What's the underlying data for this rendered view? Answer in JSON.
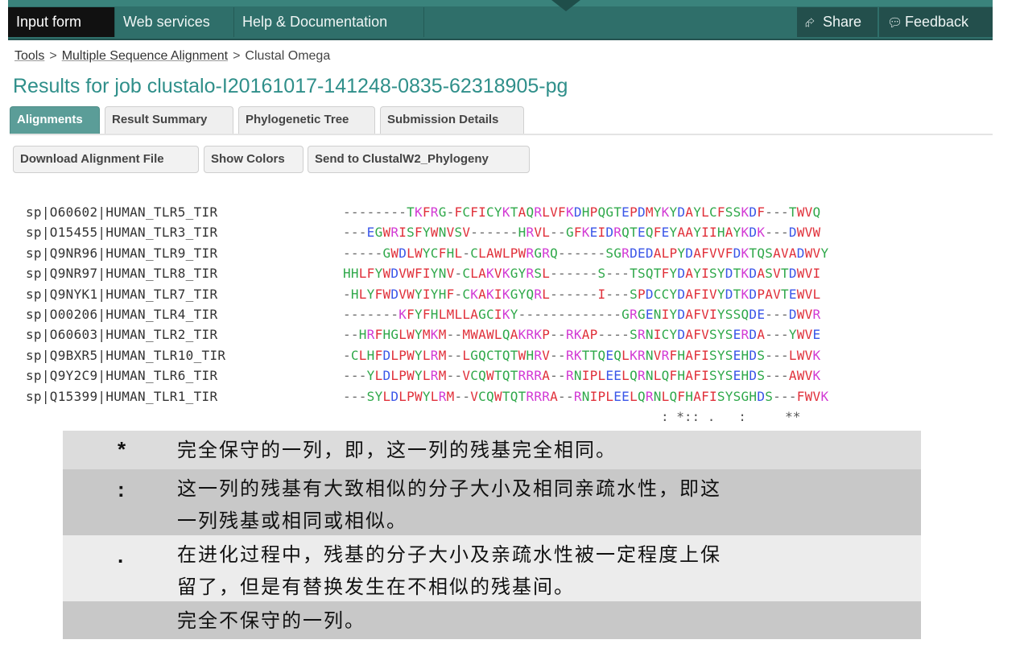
{
  "nav": {
    "tabs": [
      "Input form",
      "Web services",
      "Help & Documentation"
    ],
    "share": "Share",
    "feedback": "Feedback"
  },
  "breadcrumb": {
    "tools": "Tools",
    "sep1": ">",
    "msa": "Multiple Sequence Alignment",
    "sep2": ">",
    "current": "Clustal Omega"
  },
  "page_title": "Results for job clustalo-I20161017-141248-0835-62318905-pg",
  "result_tabs": [
    "Alignments",
    "Result Summary",
    "Phylogenetic Tree",
    "Submission Details"
  ],
  "buttons": {
    "download": "Download Alignment File",
    "colors": "Show Colors",
    "send": "Send to ClustalW2_Phylogeny"
  },
  "alignment": {
    "rows": [
      {
        "name": "sp|O60602|HUMAN_TLR5_TIR",
        "seq": "--------TKFRG-FCFICYKTAQRLVFKDHPQGTEPDMYKYDAYLCFSSKDF---TWVQ"
      },
      {
        "name": "sp|O15455|HUMAN_TLR3_TIR",
        "seq": "---EGWRISFYWNVSV------HRVL--GFKEIDRQTEQFEYAAYIIHAYKDK---DWVW"
      },
      {
        "name": "sp|Q9NR96|HUMAN_TLR9_TIR",
        "seq": "-----GWDLWYCFHL-CLAWLPWRGRQ------SGRDEDALPYDAFVVFDKTQSAVADWVY"
      },
      {
        "name": "sp|Q9NR97|HUMAN_TLR8_TIR",
        "seq": "HHLFYWDVWFIYNV-CLAKVKGYRSL------S---TSQTFYDAYISYDTKDASVTDWVI"
      },
      {
        "name": "sp|Q9NYK1|HUMAN_TLR7_TIR",
        "seq": "-HLYFWDVWYIYHF-CKAKIKGYQRL------I---SPDCCYDAFIVYDTKDPAVTEWVL"
      },
      {
        "name": "sp|O00206|HUMAN_TLR4_TIR",
        "seq": "-------KFYFHLMLLAGCIKY-------------GRGENIYDAFVIYSSQDE---DWVR"
      },
      {
        "name": "sp|O60603|HUMAN_TLR2_TIR",
        "seq": "--HRFHGLWYMKM--MWAWLQAKRKP--RKAP----SRNICYDAFVSYSERDA---YWVE"
      },
      {
        "name": "sp|Q9BXR5|HUMAN_TLR10_TIR",
        "seq": "-CLHFDLPWYLRM--LGQCTQTWHRV--RKTTQEQLKRNVRFHAFISYSEHDS---LWVK"
      },
      {
        "name": "sp|Q9Y2C9|HUMAN_TLR6_TIR",
        "seq": "---YLDLPWYLRM--VCQWTQTRRRA--RNIPLEELQRNLQFHAFISYSEHDS---AWVK"
      },
      {
        "name": "sp|Q15399|HUMAN_TLR1_TIR",
        "seq": "---SYLDLPWYLRM--VCQWTQTRRRA--RNIPLEELQRNLQFHAFISYSGHDS---FWVK"
      }
    ],
    "consensus": "                                         : *:: .   :     **"
  },
  "legend": [
    {
      "symbol": "*",
      "lines": [
        "完全保守的一列，即，这一列的残基完全相同。"
      ],
      "bg": "#dcdcdc"
    },
    {
      "symbol": ":",
      "lines": [
        "这一列的残基有大致相似的分子大小及相同亲疏水性，即这",
        "一列残基或相同或相似。"
      ],
      "bg": "#c8c8c8"
    },
    {
      "symbol": ".",
      "lines": [
        "在进化过程中，残基的分子大小及亲疏水性被一定程度上保",
        "留了，但是有替换发生在不相似的残基间。"
      ],
      "bg": "#ececec"
    },
    {
      "symbol": "",
      "lines": [
        "完全不保守的一列。"
      ],
      "bg": "#c8c8c8"
    }
  ],
  "colors": {
    "header_bg": "#2f6f6a",
    "title": "#2f8f8a",
    "active_tab": "#5b9d98",
    "residue_red": "#e0303a",
    "residue_blue": "#3a56e8",
    "residue_magenta": "#d23ad4",
    "residue_green": "#2fa84a"
  },
  "icons": {
    "share": "share-icon",
    "feedback": "speech-bubble-icon"
  }
}
